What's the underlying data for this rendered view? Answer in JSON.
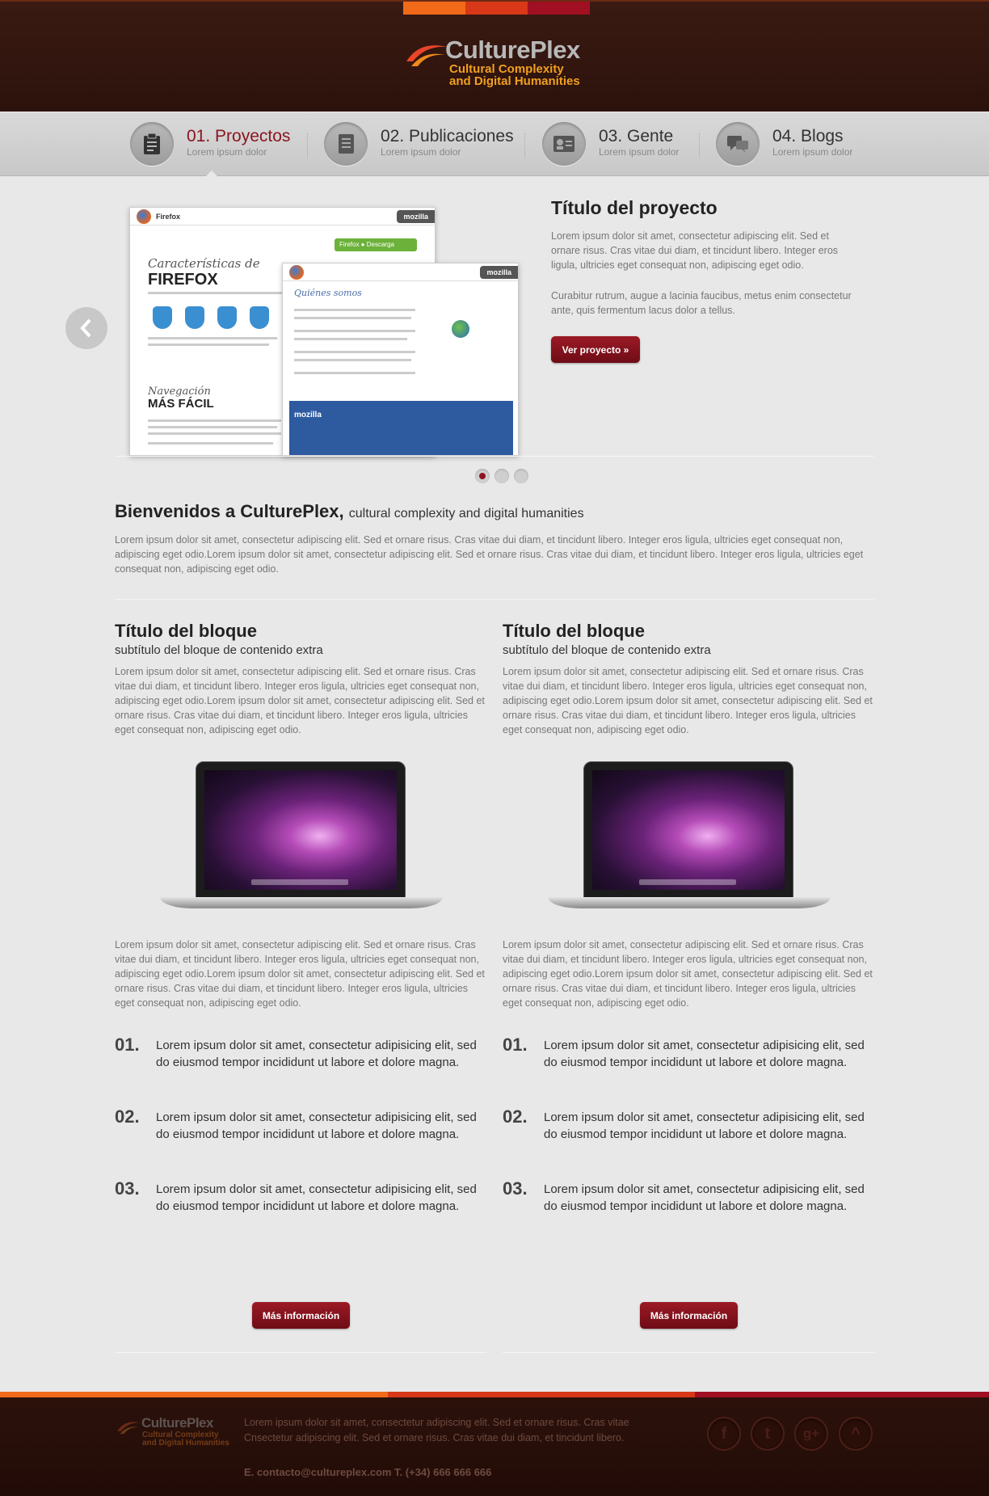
{
  "brand": {
    "name": "CulturePlex",
    "tagline_line1": "Cultural Complexity",
    "tagline_line2": "and Digital Humanities",
    "colors": {
      "accent": "#8b1520",
      "header_bg": "#2c120c",
      "stripe": [
        "#f06a1a",
        "#d83818",
        "#a01022"
      ]
    }
  },
  "nav": {
    "items": [
      {
        "title": "01. Proyectos",
        "sub": "Lorem ipsum dolor",
        "icon": "clipboard-icon",
        "active": true
      },
      {
        "title": "02. Publicaciones",
        "sub": "Lorem ipsum dolor",
        "icon": "notebook-icon",
        "active": false
      },
      {
        "title": "03. Gente",
        "sub": "Lorem ipsum dolor",
        "icon": "contact-card-icon",
        "active": false
      },
      {
        "title": "04. Blogs",
        "sub": "Lorem ipsum dolor",
        "icon": "chat-bubbles-icon",
        "active": false
      }
    ]
  },
  "slider": {
    "title": "Título del proyecto",
    "p1": "Lorem ipsum dolor sit amet, consectetur adipiscing elit. Sed et ornare risus. Cras vitae dui diam, et tincidunt libero. Integer eros ligula, ultricies eget consequat non, adipiscing eget odio.",
    "p2": "Curabitur rutrum, augue a lacinia faucibus, metus enim consectetur ante, quis fermentum lacus dolor a tellus.",
    "button": "Ver proyecto »",
    "active_slide": 1,
    "slide_count": 3,
    "shot": {
      "brand_small": "Firefox",
      "heading1": "Características de",
      "heading2": "FIREFOX",
      "heading3": "Navegación",
      "heading4": "MÁS FÁCIL",
      "mozilla": "mozilla",
      "download": "Firefox ● Descarga gratuita",
      "second_heading": "Quiénes somos"
    }
  },
  "welcome": {
    "title": "Bienvenidos a CulturePlex,",
    "subtitle": "cultural complexity and digital humanities",
    "text": "Lorem ipsum dolor sit amet, consectetur adipiscing elit. Sed et ornare risus. Cras vitae dui diam, et tincidunt libero. Integer eros ligula, ultricies eget consequat non, adipiscing eget odio.Lorem ipsum dolor sit amet, consectetur adipiscing elit. Sed et ornare risus. Cras vitae dui diam, et tincidunt libero. Integer eros ligula, ultricies eget consequat non, adipiscing eget odio."
  },
  "columns": [
    {
      "title": "Título del bloque",
      "subtitle": "subtítulo del bloque de contenido extra",
      "text1": "Lorem ipsum dolor sit amet, consectetur adipiscing elit. Sed et ornare risus. Cras vitae dui diam, et tincidunt libero. Integer eros ligula, ultricies eget consequat non, adipiscing eget odio.Lorem ipsum dolor sit amet, consectetur adipiscing elit. Sed et ornare risus. Cras vitae dui diam, et tincidunt libero. Integer eros ligula, ultricies eget consequat non, adipiscing eget odio.",
      "text2": "Lorem ipsum dolor sit amet, consectetur adipiscing elit. Sed et ornare risus. Cras vitae dui diam, et tincidunt libero. Integer eros ligula, ultricies eget consequat non, adipiscing eget odio.Lorem ipsum dolor sit amet, consectetur adipiscing elit. Sed et ornare risus. Cras vitae dui diam, et tincidunt libero. Integer eros ligula, ultricies eget consequat non, adipiscing eget odio.",
      "list": [
        {
          "num": "01.",
          "text": "Lorem ipsum dolor sit amet, consectetur adipisicing elit, sed do eiusmod tempor incididunt ut labore et dolore magna."
        },
        {
          "num": "02.",
          "text": "Lorem ipsum dolor sit amet, consectetur adipisicing elit, sed do eiusmod tempor incididunt ut labore et dolore magna."
        },
        {
          "num": "03.",
          "text": "Lorem ipsum dolor sit amet, consectetur adipisicing elit, sed do eiusmod tempor incididunt ut labore et dolore magna."
        }
      ],
      "button": "Más información"
    },
    {
      "title": "Título del bloque",
      "subtitle": "subtítulo del bloque de contenido extra",
      "text1": "Lorem ipsum dolor sit amet, consectetur adipiscing elit. Sed et ornare risus. Cras vitae dui diam, et tincidunt libero. Integer eros ligula, ultricies eget consequat non, adipiscing eget odio.Lorem ipsum dolor sit amet, consectetur adipiscing elit. Sed et ornare risus. Cras vitae dui diam, et tincidunt libero. Integer eros ligula, ultricies eget consequat non, adipiscing eget odio.",
      "text2": "Lorem ipsum dolor sit amet, consectetur adipiscing elit. Sed et ornare risus. Cras vitae dui diam, et tincidunt libero. Integer eros ligula, ultricies eget consequat non, adipiscing eget odio.Lorem ipsum dolor sit amet, consectetur adipiscing elit. Sed et ornare risus. Cras vitae dui diam, et tincidunt libero. Integer eros ligula, ultricies eget consequat non, adipiscing eget odio.",
      "list": [
        {
          "num": "01.",
          "text": "Lorem ipsum dolor sit amet, consectetur adipisicing elit, sed do eiusmod tempor incididunt ut labore et dolore magna."
        },
        {
          "num": "02.",
          "text": "Lorem ipsum dolor sit amet, consectetur adipisicing elit, sed do eiusmod tempor incididunt ut labore et dolore magna."
        },
        {
          "num": "03.",
          "text": "Lorem ipsum dolor sit amet, consectetur adipisicing elit, sed do eiusmod tempor incididunt ut labore et dolore magna."
        }
      ],
      "button": "Más información"
    }
  ],
  "footer": {
    "text": "Lorem ipsum dolor sit amet, consectetur adipiscing elit. Sed et ornare risus. Cras vitae Cnsectetur adipiscing elit. Sed et ornare risus. Cras vitae dui diam, et tincidunt libero.",
    "contact": "E. contacto@cultureplex.com T. (+34) 666 666 666",
    "social": [
      {
        "icon": "facebook-icon",
        "glyph": "f"
      },
      {
        "icon": "twitter-icon",
        "glyph": "t"
      },
      {
        "icon": "google-plus-icon",
        "glyph": "g+"
      },
      {
        "icon": "back-to-top-icon",
        "glyph": "^"
      }
    ]
  }
}
